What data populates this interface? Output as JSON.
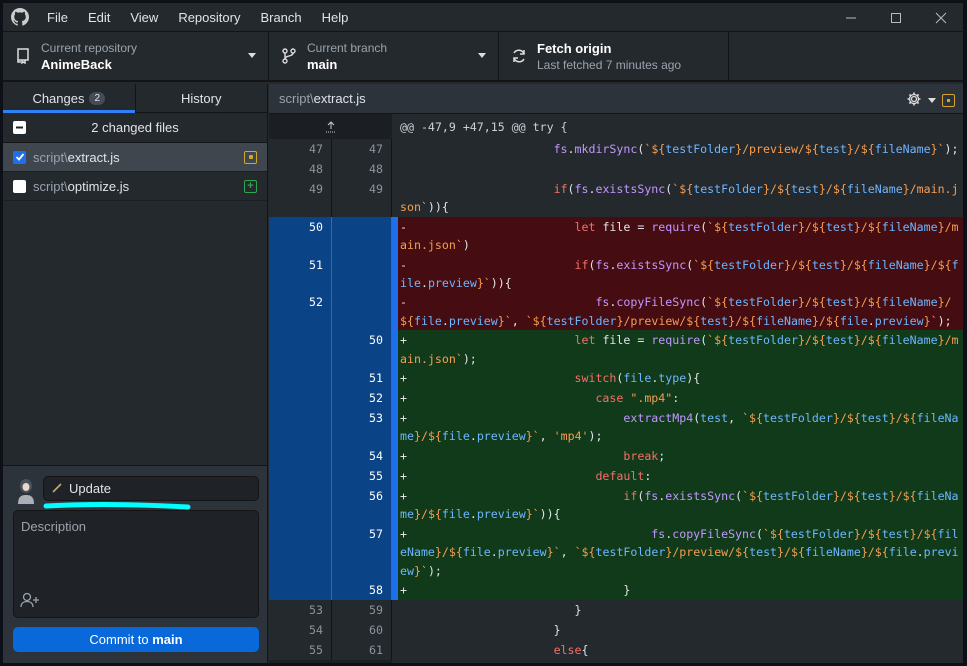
{
  "menu": [
    "File",
    "Edit",
    "View",
    "Repository",
    "Branch",
    "Help"
  ],
  "toolbar": {
    "repo": {
      "label": "Current repository",
      "value": "AnimeBack"
    },
    "branch": {
      "label": "Current branch",
      "value": "main"
    },
    "fetch": {
      "label": "Fetch origin",
      "sub": "Last fetched 7 minutes ago"
    }
  },
  "tabs": {
    "changes": "Changes",
    "changes_count": "2",
    "history": "History"
  },
  "files": {
    "header": "2 changed files",
    "items": [
      {
        "dir": "script\\",
        "name": "extract.js",
        "checked": true,
        "status": "modified",
        "status_color": "#d4a72c"
      },
      {
        "dir": "script\\",
        "name": "optimize.js",
        "checked": false,
        "status": "added",
        "status_color": "#2da44e"
      }
    ]
  },
  "commit": {
    "summary": "Update",
    "description_placeholder": "Description",
    "button_prefix": "Commit to ",
    "button_branch": "main"
  },
  "diff": {
    "file_dir": "script\\",
    "file_name": "extract.js",
    "hunk_header": "@@ -47,9 +47,15 @@ try {",
    "hunk_footer": "@@ @@",
    "rows": [
      {
        "type": "ctx",
        "old": "47",
        "new": "47",
        "text": "                      fs.mkdirSync(`${testFolder}/preview/${test}/${fileName}`);"
      },
      {
        "type": "ctx",
        "old": "48",
        "new": "48",
        "text": ""
      },
      {
        "type": "ctx",
        "old": "49",
        "new": "49",
        "text": "                      if(fs.existsSync(`${testFolder}/${test}/${fileName}/main.json`)){"
      },
      {
        "type": "del",
        "old": "50",
        "new": "",
        "text": "-                        let file = require(`${testFolder}/${test}/${fileName}/main.json`)"
      },
      {
        "type": "del",
        "old": "51",
        "new": "",
        "text": "-                        if(fs.existsSync(`${testFolder}/${test}/${fileName}/${file.preview}`)){"
      },
      {
        "type": "del",
        "old": "52",
        "new": "",
        "text": "-                           fs.copyFileSync(`${testFolder}/${test}/${fileName}/${file.preview}`, `${testFolder}/preview/${test}/${fileName}/${file.preview}`);"
      },
      {
        "type": "add",
        "old": "",
        "new": "50",
        "text": "+                        let file = require(`${testFolder}/${test}/${fileName}/main.json`);"
      },
      {
        "type": "add",
        "old": "",
        "new": "51",
        "text": "+                        switch(file.type){"
      },
      {
        "type": "add",
        "old": "",
        "new": "52",
        "text": "+                           case \".mp4\":"
      },
      {
        "type": "add",
        "old": "",
        "new": "53",
        "text": "+                               extractMp4(test, `${testFolder}/${test}/${fileName}/${file.preview}`, 'mp4');"
      },
      {
        "type": "add",
        "old": "",
        "new": "54",
        "text": "+                               break;"
      },
      {
        "type": "add",
        "old": "",
        "new": "55",
        "text": "+                           default:"
      },
      {
        "type": "add",
        "old": "",
        "new": "56",
        "text": "+                               if(fs.existsSync(`${testFolder}/${test}/${fileName}/${file.preview}`)){"
      },
      {
        "type": "add",
        "old": "",
        "new": "57",
        "text": "+                                   fs.copyFileSync(`${testFolder}/${test}/${fileName}/${file.preview}`, `${testFolder}/preview/${test}/${fileName}/${file.preview}`);"
      },
      {
        "type": "add",
        "old": "",
        "new": "58",
        "text": "+                               }"
      },
      {
        "type": "ctx",
        "old": "53",
        "new": "59",
        "text": "                         }"
      },
      {
        "type": "ctx",
        "old": "54",
        "new": "60",
        "text": "                      }"
      },
      {
        "type": "ctx",
        "old": "55",
        "new": "61",
        "text": "                      else{"
      }
    ]
  },
  "colors": {
    "accent": "#1f6feb",
    "deleted_bg": "#450d12",
    "added_bg": "#113a1b",
    "annotation": "#00ffff"
  }
}
